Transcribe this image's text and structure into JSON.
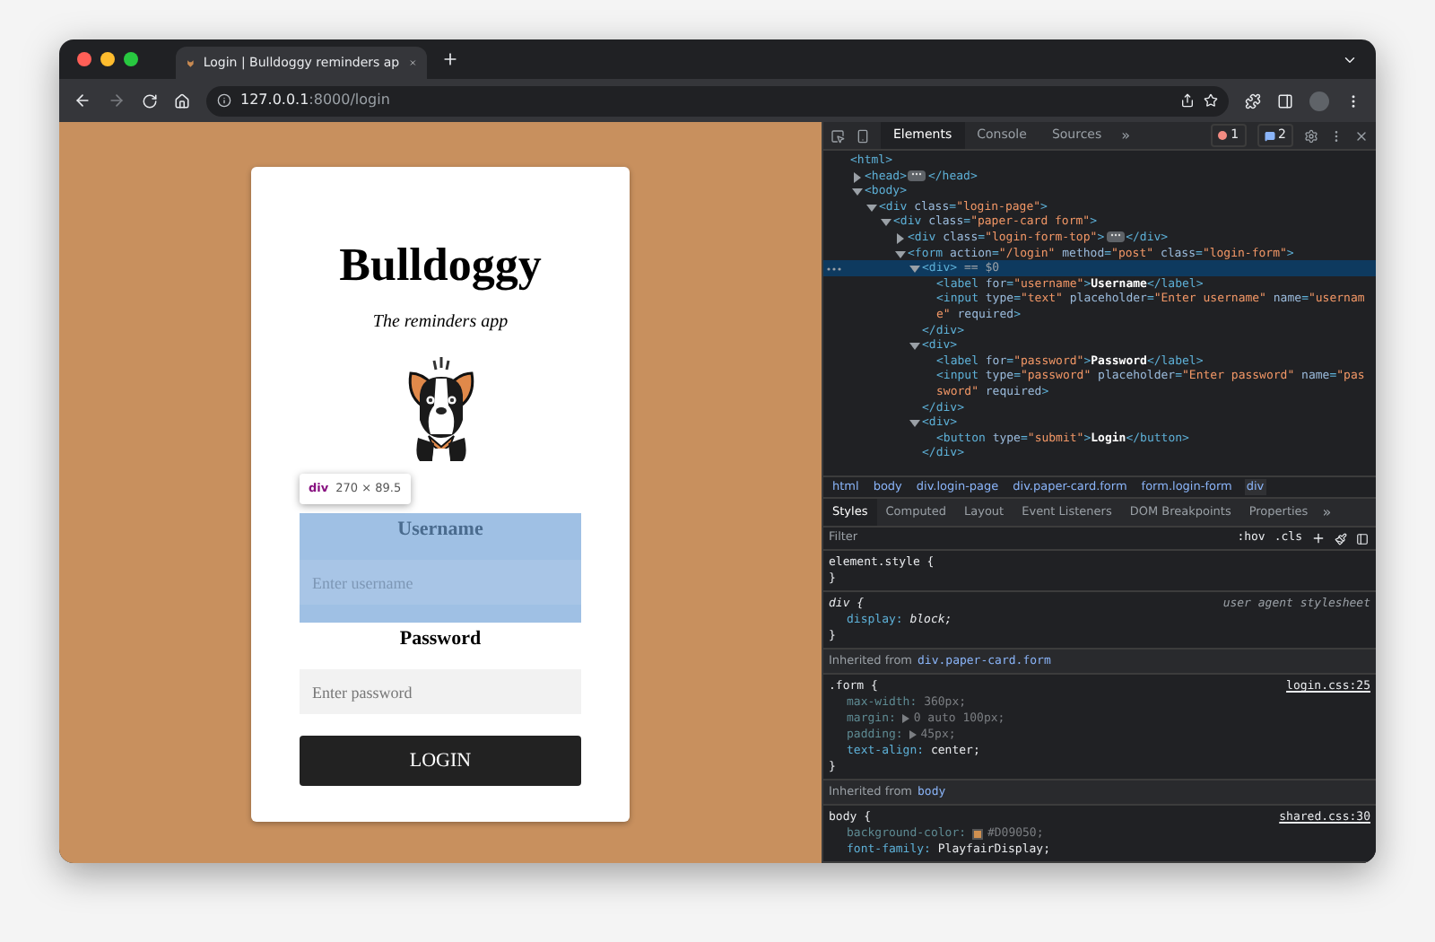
{
  "browser": {
    "tab": {
      "title": "Login | Bulldoggy reminders ap"
    },
    "address": {
      "host": "127.0.0.1",
      "path": ":8000/login"
    }
  },
  "page": {
    "title": "Bulldoggy",
    "subtitle": "The reminders app",
    "inspect_tooltip": {
      "tag": "div",
      "size": "270 × 89.5"
    },
    "fields": [
      {
        "label": "Username",
        "placeholder": "Enter username",
        "highlighted": true
      },
      {
        "label": "Password",
        "placeholder": "Enter password",
        "highlighted": false
      }
    ],
    "button": "LOGIN"
  },
  "devtools": {
    "tabs": [
      {
        "label": "Elements",
        "selected": true
      },
      {
        "label": "Console",
        "selected": false
      },
      {
        "label": "Sources",
        "selected": false
      }
    ],
    "more_tabs": "»",
    "errors": "1",
    "messages": "2",
    "dom_tree": [
      {
        "selected": false,
        "line": [
          {
            "kind": "tag",
            "text": "<html>"
          }
        ],
        "children": [
          {
            "selected": false,
            "expanded": false,
            "line": [
              {
                "kind": "tag",
                "text": "<head>"
              },
              {
                "kind": "more"
              },
              {
                "kind": "tag",
                "text": "</head>"
              }
            ]
          },
          {
            "selected": false,
            "expanded": true,
            "line": [
              {
                "kind": "tag",
                "text": "<body>"
              }
            ],
            "children": [
              {
                "selected": false,
                "expanded": true,
                "line": [
                  {
                    "kind": "tag",
                    "text": "<div"
                  },
                  {
                    "kind": "attr",
                    "text": " class"
                  },
                  {
                    "kind": "tag",
                    "text": "="
                  },
                  {
                    "kind": "val",
                    "text": "\"login-page\""
                  },
                  {
                    "kind": "tag",
                    "text": ">"
                  }
                ],
                "children": [
                  {
                    "selected": false,
                    "expanded": true,
                    "line": [
                      {
                        "kind": "tag",
                        "text": "<div"
                      },
                      {
                        "kind": "attr",
                        "text": " class"
                      },
                      {
                        "kind": "tag",
                        "text": "="
                      },
                      {
                        "kind": "val",
                        "text": "\"paper-card form\""
                      },
                      {
                        "kind": "tag",
                        "text": ">"
                      }
                    ],
                    "children": [
                      {
                        "selected": false,
                        "expanded": false,
                        "line": [
                          {
                            "kind": "tag",
                            "text": "<div"
                          },
                          {
                            "kind": "attr",
                            "text": " class"
                          },
                          {
                            "kind": "tag",
                            "text": "="
                          },
                          {
                            "kind": "val",
                            "text": "\"login-form-top\""
                          },
                          {
                            "kind": "tag",
                            "text": ">"
                          },
                          {
                            "kind": "more"
                          },
                          {
                            "kind": "tag",
                            "text": "</div>"
                          }
                        ]
                      },
                      {
                        "selected": false,
                        "expanded": true,
                        "line": [
                          {
                            "kind": "tag",
                            "text": "<form"
                          },
                          {
                            "kind": "attr",
                            "text": " action"
                          },
                          {
                            "kind": "tag",
                            "text": "="
                          },
                          {
                            "kind": "val",
                            "text": "\"/login\""
                          },
                          {
                            "kind": "attr",
                            "text": " method"
                          },
                          {
                            "kind": "tag",
                            "text": "="
                          },
                          {
                            "kind": "val",
                            "text": "\"post\""
                          },
                          {
                            "kind": "attr",
                            "text": " class"
                          },
                          {
                            "kind": "tag",
                            "text": "="
                          },
                          {
                            "kind": "val",
                            "text": "\"login-form\""
                          },
                          {
                            "kind": "tag",
                            "text": ">"
                          }
                        ],
                        "children": [
                          {
                            "selected": true,
                            "expanded": true,
                            "line": [
                              {
                                "kind": "tag",
                                "text": "<div>"
                              },
                              {
                                "kind": "ref",
                                "text": " == $0"
                              }
                            ],
                            "close": "</div>",
                            "children": [
                              {
                                "selected": false,
                                "line": [
                                  {
                                    "kind": "tag",
                                    "text": "<label"
                                  },
                                  {
                                    "kind": "attr",
                                    "text": " for"
                                  },
                                  {
                                    "kind": "tag",
                                    "text": "="
                                  },
                                  {
                                    "kind": "val",
                                    "text": "\"username\""
                                  },
                                  {
                                    "kind": "tag",
                                    "text": ">"
                                  },
                                  {
                                    "kind": "text",
                                    "text": "Username"
                                  },
                                  {
                                    "kind": "tag",
                                    "text": "</label>"
                                  }
                                ]
                              },
                              {
                                "selected": false,
                                "line": [
                                  {
                                    "kind": "tag",
                                    "text": "<input"
                                  },
                                  {
                                    "kind": "attr",
                                    "text": " type"
                                  },
                                  {
                                    "kind": "tag",
                                    "text": "="
                                  },
                                  {
                                    "kind": "val",
                                    "text": "\"text\""
                                  },
                                  {
                                    "kind": "attr",
                                    "text": " placeholder"
                                  },
                                  {
                                    "kind": "tag",
                                    "text": "="
                                  },
                                  {
                                    "kind": "val",
                                    "text": "\"Enter username\""
                                  },
                                  {
                                    "kind": "attr",
                                    "text": " name"
                                  },
                                  {
                                    "kind": "tag",
                                    "text": "="
                                  },
                                  {
                                    "kind": "val",
                                    "text": "\"username\""
                                  },
                                  {
                                    "kind": "attr",
                                    "text": " required"
                                  },
                                  {
                                    "kind": "tag",
                                    "text": ">"
                                  }
                                ]
                              }
                            ]
                          },
                          {
                            "selected": false,
                            "expanded": true,
                            "line": [
                              {
                                "kind": "tag",
                                "text": "<div>"
                              }
                            ],
                            "close": "</div>",
                            "children": [
                              {
                                "selected": false,
                                "line": [
                                  {
                                    "kind": "tag",
                                    "text": "<label"
                                  },
                                  {
                                    "kind": "attr",
                                    "text": " for"
                                  },
                                  {
                                    "kind": "tag",
                                    "text": "="
                                  },
                                  {
                                    "kind": "val",
                                    "text": "\"password\""
                                  },
                                  {
                                    "kind": "tag",
                                    "text": ">"
                                  },
                                  {
                                    "kind": "text",
                                    "text": "Password"
                                  },
                                  {
                                    "kind": "tag",
                                    "text": "</label>"
                                  }
                                ]
                              },
                              {
                                "selected": false,
                                "line": [
                                  {
                                    "kind": "tag",
                                    "text": "<input"
                                  },
                                  {
                                    "kind": "attr",
                                    "text": " type"
                                  },
                                  {
                                    "kind": "tag",
                                    "text": "="
                                  },
                                  {
                                    "kind": "val",
                                    "text": "\"password\""
                                  },
                                  {
                                    "kind": "attr",
                                    "text": " placeholder"
                                  },
                                  {
                                    "kind": "tag",
                                    "text": "="
                                  },
                                  {
                                    "kind": "val",
                                    "text": "\"Enter password\""
                                  },
                                  {
                                    "kind": "attr",
                                    "text": " name"
                                  },
                                  {
                                    "kind": "tag",
                                    "text": "="
                                  },
                                  {
                                    "kind": "val",
                                    "text": "\"password\""
                                  },
                                  {
                                    "kind": "attr",
                                    "text": " required"
                                  },
                                  {
                                    "kind": "tag",
                                    "text": ">"
                                  }
                                ]
                              }
                            ]
                          },
                          {
                            "selected": false,
                            "expanded": true,
                            "line": [
                              {
                                "kind": "tag",
                                "text": "<div>"
                              }
                            ],
                            "close": "</div>",
                            "children": [
                              {
                                "selected": false,
                                "line": [
                                  {
                                    "kind": "tag",
                                    "text": "<button"
                                  },
                                  {
                                    "kind": "attr",
                                    "text": " type"
                                  },
                                  {
                                    "kind": "tag",
                                    "text": "="
                                  },
                                  {
                                    "kind": "val",
                                    "text": "\"submit\""
                                  },
                                  {
                                    "kind": "tag",
                                    "text": ">"
                                  },
                                  {
                                    "kind": "text",
                                    "text": "Login"
                                  },
                                  {
                                    "kind": "tag",
                                    "text": "</button>"
                                  }
                                ]
                              }
                            ]
                          }
                        ]
                      }
                    ]
                  }
                ]
              }
            ]
          }
        ]
      }
    ],
    "breadcrumbs": [
      {
        "label": "html",
        "selected": false
      },
      {
        "label": "body",
        "selected": false
      },
      {
        "label": "div.login-page",
        "selected": false
      },
      {
        "label": "div.paper-card.form",
        "selected": false
      },
      {
        "label": "form.login-form",
        "selected": false
      },
      {
        "label": "div",
        "selected": true
      }
    ],
    "pane_tabs": [
      {
        "label": "Styles",
        "selected": true
      },
      {
        "label": "Computed",
        "selected": false
      },
      {
        "label": "Layout",
        "selected": false
      },
      {
        "label": "Event Listeners",
        "selected": false
      },
      {
        "label": "DOM Breakpoints",
        "selected": false
      },
      {
        "label": "Properties",
        "selected": false
      }
    ],
    "more_pane_tabs": "»",
    "filter": {
      "placeholder": "Filter"
    },
    "filter_buttons": [
      ":hov",
      ".cls"
    ],
    "style_sections": [
      {
        "kind": "rule",
        "selector": "element.style {",
        "close": "}"
      },
      {
        "kind": "rule",
        "selector": "div {",
        "close": "}",
        "source": "user agent stylesheet",
        "source_link": false,
        "declarations": [
          {
            "property": "display:",
            "value": "block;",
            "inactive": false
          }
        ]
      },
      {
        "kind": "inherited",
        "label": "Inherited from",
        "link": "div.paper-card.form"
      },
      {
        "kind": "rule",
        "selector": ".form {",
        "close": "}",
        "source": "login.css:25",
        "source_link": true,
        "declarations": [
          {
            "property": "max-width:",
            "value": "360px;",
            "inactive": true
          },
          {
            "property": "margin:",
            "value": "0 auto 100px;",
            "inactive": true,
            "expandable": true
          },
          {
            "property": "padding:",
            "value": "45px;",
            "inactive": true,
            "expandable": true
          },
          {
            "property": "text-align:",
            "value": "center;",
            "inactive": false
          }
        ]
      },
      {
        "kind": "inherited",
        "label": "Inherited from",
        "link": "body"
      },
      {
        "kind": "rule",
        "selector": "body {",
        "source": "shared.css:30",
        "source_link": true,
        "declarations": [
          {
            "property": "background-color:",
            "value": "#D09050;",
            "inactive": true,
            "color": "#d09050"
          },
          {
            "property": "font-family:",
            "value": "PlayfairDisplay;",
            "inactive": false
          }
        ]
      }
    ]
  }
}
